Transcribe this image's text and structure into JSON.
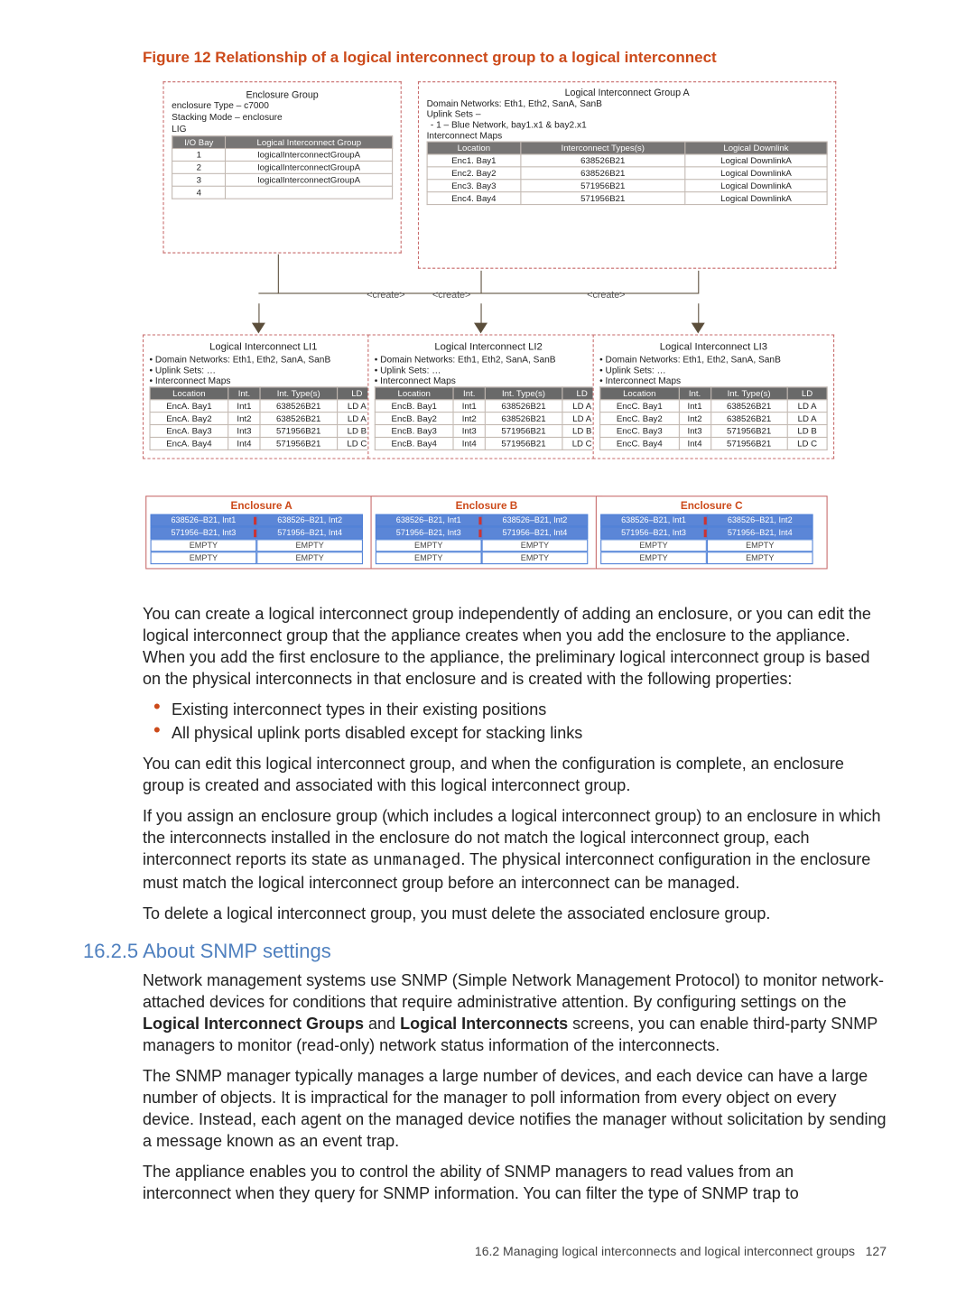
{
  "figure": {
    "caption": "Figure 12 Relationship of a logical interconnect group to a logical interconnect",
    "encGroup": {
      "title": "Enclosure Group",
      "enclosureType": "enclosure Type – c7000",
      "stackingMode": "Stacking Mode – enclosure",
      "ligLabel": "LIG",
      "tableHeaders": [
        "I/O Bay",
        "Logical Interconnect Group"
      ],
      "rows": [
        {
          "bay": "1",
          "lig": "logicalInterconnectGroupA"
        },
        {
          "bay": "2",
          "lig": "logicalInterconnectGroupA"
        },
        {
          "bay": "3",
          "lig": "logicalInterconnectGroupA"
        },
        {
          "bay": "4",
          "lig": ""
        }
      ]
    },
    "ligA": {
      "title": "Logical Interconnect Group A",
      "domainNetworks": "Domain Networks: Eth1, Eth2, SanA, SanB",
      "uplinkSets": "Uplink Sets –",
      "uplink1": "- 1 – Blue Network, bay1.x1 & bay2.x1",
      "interconnectMaps": "Interconnect Maps",
      "headers": [
        "Location",
        "Interconnect Types(s)",
        "Logical Downlink"
      ],
      "rows": [
        {
          "loc": "Enc1. Bay1",
          "type": "638526B21",
          "dl": "Logical DownlinkA"
        },
        {
          "loc": "Enc2. Bay2",
          "type": "638526B21",
          "dl": "Logical DownlinkA"
        },
        {
          "loc": "Enc3. Bay3",
          "type": "571956B21",
          "dl": "Logical DownlinkA"
        },
        {
          "loc": "Enc4. Bay4",
          "type": "571956B21",
          "dl": "Logical DownlinkA"
        }
      ]
    },
    "createLabel": "<create>",
    "li": {
      "domainNetworks": "• Domain Networks: Eth1, Eth2, SanA, SanB",
      "uplinkSets": "• Uplink Sets: …",
      "interconnectMaps": "• Interconnect Maps",
      "headers": [
        "Location",
        "Int.",
        "Int. Type(s)",
        "LD"
      ],
      "titles": [
        "Logical Interconnect LI1",
        "Logical Interconnect LI2",
        "Logical Interconnect LI3"
      ],
      "prefixes": [
        "EncA",
        "EncB",
        "EncC"
      ],
      "rows": [
        {
          "bay": "Bay1",
          "int": "Int1",
          "type": "638526B21",
          "ld": "LD A"
        },
        {
          "bay": "Bay2",
          "int": "Int2",
          "type": "638526B21",
          "ld": "LD A"
        },
        {
          "bay": "Bay3",
          "int": "Int3",
          "type": "571956B21",
          "ld": "LD B"
        },
        {
          "bay": "Bay4",
          "int": "Int4",
          "type": "571956B21",
          "ld": "LD C"
        }
      ]
    },
    "enclosures": {
      "titles": [
        "Enclosure A",
        "Enclosure B",
        "Enclosure C"
      ],
      "bays": [
        [
          "638526–B21, Int1",
          "638526–B21, Int2"
        ],
        [
          "571956–B21, Int3",
          "571956–B21, Int4"
        ],
        [
          "EMPTY",
          "EMPTY"
        ],
        [
          "EMPTY",
          "EMPTY"
        ]
      ]
    }
  },
  "body": {
    "p1": "You can create a logical interconnect group independently of adding an enclosure, or you can edit the logical interconnect group that the appliance creates when you add the enclosure to the appliance. When you add the first enclosure to the appliance, the preliminary logical interconnect group is based on the physical interconnects in that enclosure and is created with the following properties:",
    "bul1": "Existing interconnect types in their existing positions",
    "bul2": "All physical uplink ports disabled except for stacking links",
    "p2": "You can edit this logical interconnect group, and when the configuration is complete, an enclosure group is created and associated with this logical interconnect group.",
    "p3a": "If you assign an enclosure group (which includes a logical interconnect group) to an enclosure in which the interconnects installed in the enclosure do not match the logical interconnect group, each interconnect reports its state as ",
    "p3code": "unmanaged",
    "p3b": ". The physical interconnect configuration in the enclosure must match the logical interconnect group before an interconnect can be managed.",
    "p4": "To delete a logical interconnect group, you must delete the associated enclosure group."
  },
  "section": {
    "heading": "16.2.5 About SNMP settings",
    "p1a": "Network management systems use SNMP (Simple Network Management Protocol) to monitor network-attached devices for conditions that require administrative attention. By configuring settings on the ",
    "p1b": "Logical Interconnect Groups",
    "p1c": " and ",
    "p1d": "Logical Interconnects",
    "p1e": " screens, you can enable third-party SNMP managers to monitor (read-only) network status information of the interconnects.",
    "p2": "The SNMP manager typically manages a large number of devices, and each device can have a large number of objects. It is impractical for the manager to poll information from every object on every device. Instead, each agent on the managed device notifies the manager without solicitation by sending a message known as an event trap.",
    "p3": "The appliance enables you to control the ability of SNMP managers to read values from an interconnect when they query for SNMP information. You can filter the type of SNMP trap to"
  },
  "footer": {
    "text": "16.2 Managing logical interconnects and logical interconnect groups",
    "page": "127"
  }
}
